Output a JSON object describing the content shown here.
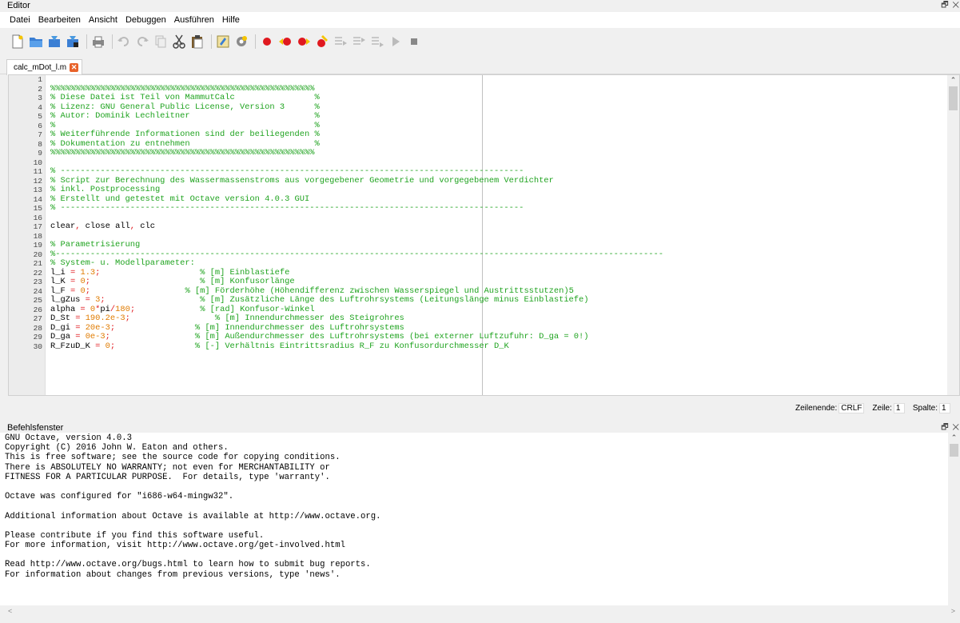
{
  "editor_title": "Editor",
  "panel_controls": "🗗 ✕",
  "menu": [
    "Datei",
    "Bearbeiten",
    "Ansicht",
    "Debuggen",
    "Ausführen",
    "Hilfe"
  ],
  "tab": {
    "filename": "calc_mDot_l.m",
    "close": "✕"
  },
  "colors": {
    "comment": "#1fa31f",
    "number": "#e07b00",
    "operator": "#e0191f",
    "tab_close": "#e8622a"
  },
  "toolbar_icons": [
    "new-file-icon",
    "open-folder-icon",
    "save-icon",
    "save-as-icon",
    "print-icon",
    "undo-icon",
    "redo-icon",
    "copy-icon",
    "cut-icon",
    "paste-icon",
    "find-icon",
    "preferences-icon",
    "toggle-breakpoint-icon",
    "next-breakpoint-icon",
    "previous-breakpoint-icon",
    "remove-breakpoints-icon",
    "step-icon",
    "step-in-icon",
    "step-out-icon",
    "continue-icon",
    "quit-debug-icon"
  ],
  "code_lines": [
    [],
    [
      [
        "cm",
        "%%%%%%%%%%%%%%%%%%%%%%%%%%%%%%%%%%%%%%%%%%%%%%%%%%%%%"
      ]
    ],
    [
      [
        "cm",
        "% Diese Datei ist Teil von MammutCalc                %"
      ]
    ],
    [
      [
        "cm",
        "% Lizenz: GNU General Public License, Version 3      %"
      ]
    ],
    [
      [
        "cm",
        "% Autor: Dominik Lechleitner                         %"
      ]
    ],
    [
      [
        "cm",
        "%                                                    %"
      ]
    ],
    [
      [
        "cm",
        "% Weiterführende Informationen sind der beiliegenden %"
      ]
    ],
    [
      [
        "cm",
        "% Dokumentation zu entnehmen                         %"
      ]
    ],
    [
      [
        "cm",
        "%%%%%%%%%%%%%%%%%%%%%%%%%%%%%%%%%%%%%%%%%%%%%%%%%%%%%"
      ]
    ],
    [],
    [
      [
        "cm",
        "% ---------------------------------------------------------------------------------------------"
      ]
    ],
    [
      [
        "cm",
        "% Script zur Berechnung des Wassermassenstroms aus vorgegebener Geometrie und vorgegebenem Verdichter"
      ]
    ],
    [
      [
        "cm",
        "% inkl. Postprocessing"
      ]
    ],
    [
      [
        "cm",
        "% Erstellt und getestet mit Octave version 4.0.3 GUI"
      ]
    ],
    [
      [
        "cm",
        "% ---------------------------------------------------------------------------------------------"
      ]
    ],
    [],
    [
      [
        "t",
        "clear"
      ],
      [
        "op",
        ","
      ],
      [
        "t",
        " close all"
      ],
      [
        "op",
        ","
      ],
      [
        "t",
        " clc"
      ]
    ],
    [],
    [
      [
        "cm",
        "% Parametrisierung"
      ]
    ],
    [
      [
        "cm",
        "%--------------------------------------------------------------------------------------------------------------------------"
      ]
    ],
    [
      [
        "cm",
        "% System- u. Modellparameter:"
      ]
    ],
    [
      [
        "t",
        "l_i "
      ],
      [
        "op",
        "="
      ],
      [
        "t",
        " "
      ],
      [
        "num",
        "1.3"
      ],
      [
        "op",
        ";"
      ],
      [
        "t",
        "                    "
      ],
      [
        "cm",
        "% [m] Einblastiefe"
      ]
    ],
    [
      [
        "t",
        "l_K "
      ],
      [
        "op",
        "="
      ],
      [
        "t",
        " "
      ],
      [
        "num",
        "0"
      ],
      [
        "op",
        ";"
      ],
      [
        "t",
        "                      "
      ],
      [
        "cm",
        "% [m] Konfusorlänge"
      ]
    ],
    [
      [
        "t",
        "l_F "
      ],
      [
        "op",
        "="
      ],
      [
        "t",
        " "
      ],
      [
        "num",
        "0"
      ],
      [
        "op",
        ";"
      ],
      [
        "t",
        "                   "
      ],
      [
        "cm",
        "% [m] Förderhöhe (Höhendifferenz zwischen Wasserspiegel und Austrittsstutzen)5"
      ]
    ],
    [
      [
        "t",
        "l_gZus "
      ],
      [
        "op",
        "="
      ],
      [
        "t",
        " "
      ],
      [
        "num",
        "3"
      ],
      [
        "op",
        ";"
      ],
      [
        "t",
        "                   "
      ],
      [
        "cm",
        "% [m] Zusätzliche Länge des Luftrohrsystems (Leitungslänge minus Einblastiefe)"
      ]
    ],
    [
      [
        "t",
        "alpha "
      ],
      [
        "op",
        "="
      ],
      [
        "t",
        " "
      ],
      [
        "num",
        "0"
      ],
      [
        "op",
        "*"
      ],
      [
        "t",
        "pi"
      ],
      [
        "op",
        "/"
      ],
      [
        "num",
        "180"
      ],
      [
        "op",
        ";"
      ],
      [
        "t",
        "             "
      ],
      [
        "cm",
        "% [rad] Konfusor-Winkel"
      ]
    ],
    [
      [
        "t",
        "D_St "
      ],
      [
        "op",
        "="
      ],
      [
        "t",
        " "
      ],
      [
        "num",
        "190.2e-3"
      ],
      [
        "op",
        ";"
      ],
      [
        "t",
        "                 "
      ],
      [
        "cm",
        "% [m] Innendurchmesser des Steigrohres"
      ]
    ],
    [
      [
        "t",
        "D_gi "
      ],
      [
        "op",
        "="
      ],
      [
        "t",
        " "
      ],
      [
        "num",
        "20e-3"
      ],
      [
        "op",
        ";"
      ],
      [
        "t",
        "                "
      ],
      [
        "cm",
        "% [m] Innendurchmesser des Luftrohrsystems"
      ]
    ],
    [
      [
        "t",
        "D_ga "
      ],
      [
        "op",
        "="
      ],
      [
        "t",
        " "
      ],
      [
        "num",
        "0e-3"
      ],
      [
        "op",
        ";"
      ],
      [
        "t",
        "                 "
      ],
      [
        "cm",
        "% [m] Außendurchmesser des Luftrohrsystems (bei externer Luftzufuhr: D_ga = 0!)"
      ]
    ],
    [
      [
        "t",
        "R_FzuD_K "
      ],
      [
        "op",
        "="
      ],
      [
        "t",
        " "
      ],
      [
        "num",
        "0"
      ],
      [
        "op",
        ";"
      ],
      [
        "t",
        "                "
      ],
      [
        "cm",
        "% [-] Verhältnis Eintrittsradius R_F zu Konfusordurchmesser D_K"
      ]
    ]
  ],
  "status": {
    "eol_label": "Zeilenende:",
    "eol_value": "CRLF",
    "line_label": "Zeile:",
    "line_value": "1",
    "col_label": "Spalte:",
    "col_value": "1"
  },
  "cmd_title": "Befehlsfenster",
  "cmd_lines": [
    "GNU Octave, version 4.0.3",
    "Copyright (C) 2016 John W. Eaton and others.",
    "This is free software; see the source code for copying conditions.",
    "There is ABSOLUTELY NO WARRANTY; not even for MERCHANTABILITY or",
    "FITNESS FOR A PARTICULAR PURPOSE.  For details, type 'warranty'.",
    "",
    "Octave was configured for \"i686-w64-mingw32\".",
    "",
    "Additional information about Octave is available at http://www.octave.org.",
    "",
    "Please contribute if you find this software useful.",
    "For more information, visit http://www.octave.org/get-involved.html",
    "",
    "Read http://www.octave.org/bugs.html to learn how to submit bug reports.",
    "For information about changes from previous versions, type 'news'."
  ]
}
